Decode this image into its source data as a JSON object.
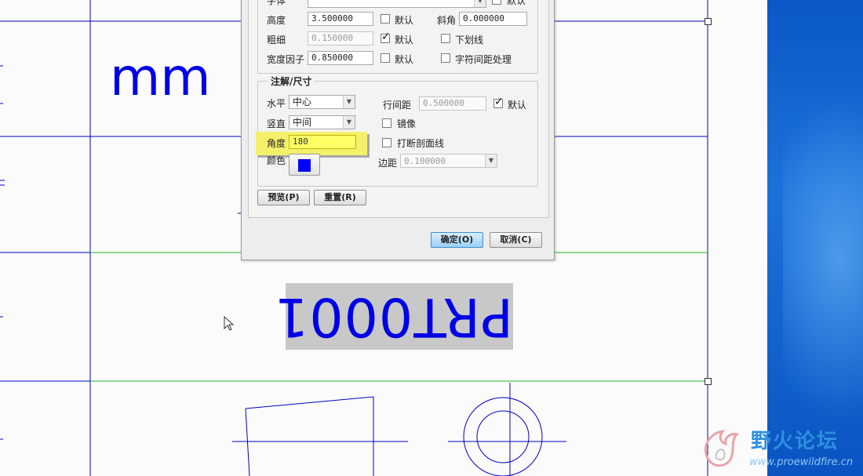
{
  "drawing": {
    "unit_text": "mm",
    "note_text": "PRT0001"
  },
  "text_group": {
    "font_label": "字体",
    "font_default": "默认",
    "height_label": "高度",
    "height_value": "3.500000",
    "height_default": "默认",
    "slant_label": "斜角",
    "slant_value": "0.000000",
    "thickness_label": "粗细",
    "thickness_value": "0.150000",
    "thickness_default": "默认",
    "underline_label": "下划线",
    "width_factor_label": "宽度因子",
    "width_factor_value": "0.850000",
    "width_factor_default": "默认",
    "kerning_label": "字符间距处理"
  },
  "note_group": {
    "title": "注解/尺寸",
    "horizontal_label": "水平",
    "horizontal_value": "中心",
    "vertical_label": "竖直",
    "vertical_value": "中间",
    "angle_label": "角度",
    "angle_value": "180",
    "color_label": "颜色",
    "line_spacing_label": "行间距",
    "line_spacing_value": "0.500000",
    "line_spacing_default": "默认",
    "mirror_label": "镜像",
    "break_hatch_label": "打断剖面线",
    "margin_label": "边距",
    "margin_value": "0.100000",
    "color_value": "#0000ff"
  },
  "buttons": {
    "preview": "预览(P)",
    "reset": "重置(R)",
    "ok": "确定(O)",
    "cancel": "取消(C)"
  },
  "watermark": {
    "title": "野火论坛",
    "url": "www.proewildfire.cn"
  }
}
